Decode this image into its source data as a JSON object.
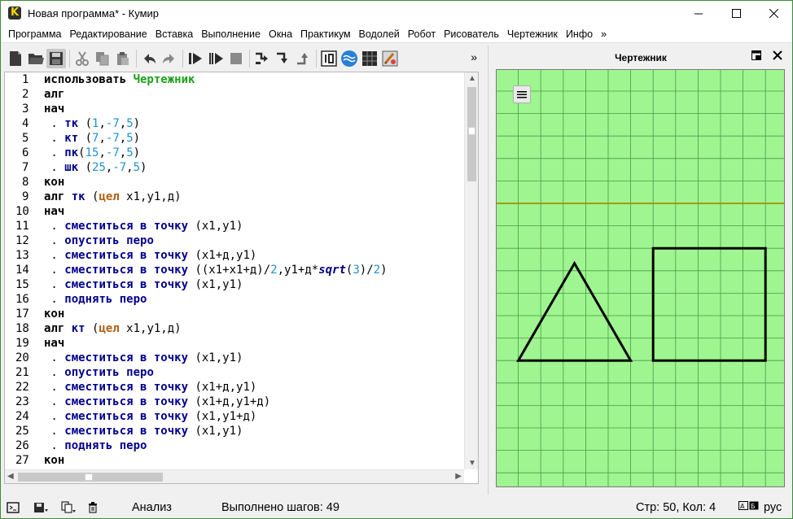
{
  "window": {
    "title": "Новая программа* - Кумир",
    "icon": "kumir-logo-icon"
  },
  "menu": {
    "items": [
      "Программа",
      "Редактирование",
      "Вставка",
      "Выполнение",
      "Окна",
      "Практикум",
      "Водолей",
      "Робот",
      "Рисователь",
      "Чертежник",
      "Инфо",
      "»"
    ]
  },
  "toolbar": {
    "more_label": "»",
    "buttons": [
      "new-file-icon",
      "open-folder-icon",
      "save-icon",
      "cut-icon",
      "copy-icon",
      "paste-icon",
      "undo-icon",
      "redo-icon",
      "run-icon",
      "run-step-icon",
      "stop-icon",
      "step-over-icon",
      "step-into-icon",
      "step-out-icon",
      "numbers-icon",
      "waves-icon",
      "grid-icon",
      "drawer-icon"
    ]
  },
  "editor": {
    "lines": [
      [
        [
          "kw",
          "использовать "
        ],
        [
          "mod",
          "Чертежник"
        ]
      ],
      [
        [
          "kw",
          "алг"
        ]
      ],
      [
        [
          "kw",
          "нач"
        ]
      ],
      [
        [
          "dot",
          " . "
        ],
        [
          "kwb",
          "тк"
        ],
        [
          "txt",
          " ("
        ],
        [
          "num",
          "1"
        ],
        [
          "txt",
          ","
        ],
        [
          "num",
          "-7"
        ],
        [
          "txt",
          ","
        ],
        [
          "num",
          "5"
        ],
        [
          "txt",
          ")"
        ]
      ],
      [
        [
          "dot",
          " . "
        ],
        [
          "kwb",
          "кт"
        ],
        [
          "txt",
          " ("
        ],
        [
          "num",
          "7"
        ],
        [
          "txt",
          ","
        ],
        [
          "num",
          "-7"
        ],
        [
          "txt",
          ","
        ],
        [
          "num",
          "5"
        ],
        [
          "txt",
          ")"
        ]
      ],
      [
        [
          "dot",
          " . "
        ],
        [
          "kwb",
          "пк"
        ],
        [
          "txt",
          "("
        ],
        [
          "num",
          "15"
        ],
        [
          "txt",
          ","
        ],
        [
          "num",
          "-7"
        ],
        [
          "txt",
          ","
        ],
        [
          "num",
          "5"
        ],
        [
          "txt",
          ")"
        ]
      ],
      [
        [
          "dot",
          " . "
        ],
        [
          "kwb",
          "шк"
        ],
        [
          "txt",
          " ("
        ],
        [
          "num",
          "25"
        ],
        [
          "txt",
          ","
        ],
        [
          "num",
          "-7"
        ],
        [
          "txt",
          ","
        ],
        [
          "num",
          "5"
        ],
        [
          "txt",
          ")"
        ]
      ],
      [
        [
          "kw",
          "кон"
        ]
      ],
      [
        [
          "kw",
          "алг "
        ],
        [
          "kwb",
          "тк"
        ],
        [
          "txt",
          " ("
        ],
        [
          "typ",
          "цел"
        ],
        [
          "txt",
          " x1,y1,д)"
        ]
      ],
      [
        [
          "kw",
          "нач"
        ]
      ],
      [
        [
          "dot",
          " . "
        ],
        [
          "kwb",
          "сместиться в точку"
        ],
        [
          "txt",
          " (x1,y1)"
        ]
      ],
      [
        [
          "dot",
          " . "
        ],
        [
          "kwb",
          "опустить перо"
        ]
      ],
      [
        [
          "dot",
          " . "
        ],
        [
          "kwb",
          "сместиться в точку"
        ],
        [
          "txt",
          " (x1+д,y1)"
        ]
      ],
      [
        [
          "dot",
          " . "
        ],
        [
          "kwb",
          "сместиться в точку"
        ],
        [
          "txt",
          " ((x1+x1+д)/"
        ],
        [
          "num",
          "2"
        ],
        [
          "txt",
          ",y1+д*"
        ],
        [
          "fn",
          "sqrt"
        ],
        [
          "txt",
          "("
        ],
        [
          "num",
          "3"
        ],
        [
          "txt",
          ")/"
        ],
        [
          "num",
          "2"
        ],
        [
          "txt",
          ")"
        ]
      ],
      [
        [
          "dot",
          " . "
        ],
        [
          "kwb",
          "сместиться в точку"
        ],
        [
          "txt",
          " (x1,y1)"
        ]
      ],
      [
        [
          "dot",
          " . "
        ],
        [
          "kwb",
          "поднять перо"
        ]
      ],
      [
        [
          "kw",
          "кон"
        ]
      ],
      [
        [
          "kw",
          "алг "
        ],
        [
          "kwb",
          "кт"
        ],
        [
          "txt",
          " ("
        ],
        [
          "typ",
          "цел"
        ],
        [
          "txt",
          " x1,y1,д)"
        ]
      ],
      [
        [
          "kw",
          "нач"
        ]
      ],
      [
        [
          "dot",
          " . "
        ],
        [
          "kwb",
          "сместиться в точку"
        ],
        [
          "txt",
          " (x1,y1)"
        ]
      ],
      [
        [
          "dot",
          " . "
        ],
        [
          "kwb",
          "опустить перо"
        ]
      ],
      [
        [
          "dot",
          " . "
        ],
        [
          "kwb",
          "сместиться в точку"
        ],
        [
          "txt",
          " (x1+д,y1)"
        ]
      ],
      [
        [
          "dot",
          " . "
        ],
        [
          "kwb",
          "сместиться в точку"
        ],
        [
          "txt",
          " (x1+д,y1+д)"
        ]
      ],
      [
        [
          "dot",
          " . "
        ],
        [
          "kwb",
          "сместиться в точку"
        ],
        [
          "txt",
          " (x1,y1+д)"
        ]
      ],
      [
        [
          "dot",
          " . "
        ],
        [
          "kwb",
          "сместиться в точку"
        ],
        [
          "txt",
          " (x1,y1)"
        ]
      ],
      [
        [
          "dot",
          " . "
        ],
        [
          "kwb",
          "поднять перо"
        ]
      ],
      [
        [
          "kw",
          "кон"
        ]
      ]
    ]
  },
  "drawer": {
    "title": "Чертежник",
    "background_color": "#9ff58f",
    "grid_color": "#4a9a4a",
    "axis_color": "#a09000",
    "x_range": [
      0,
      13
    ],
    "y_range": [
      -12,
      6
    ],
    "triangle": [
      [
        1,
        -7
      ],
      [
        6,
        -7
      ],
      [
        3.5,
        -2.67
      ]
    ],
    "square": [
      [
        7,
        -7
      ],
      [
        12,
        -7
      ],
      [
        12,
        -2
      ],
      [
        7,
        -2
      ]
    ]
  },
  "status": {
    "analysis": "Анализ",
    "steps": "Выполнено шагов: 49",
    "position": "Стр: 50, Кол: 4",
    "language": "рус"
  }
}
